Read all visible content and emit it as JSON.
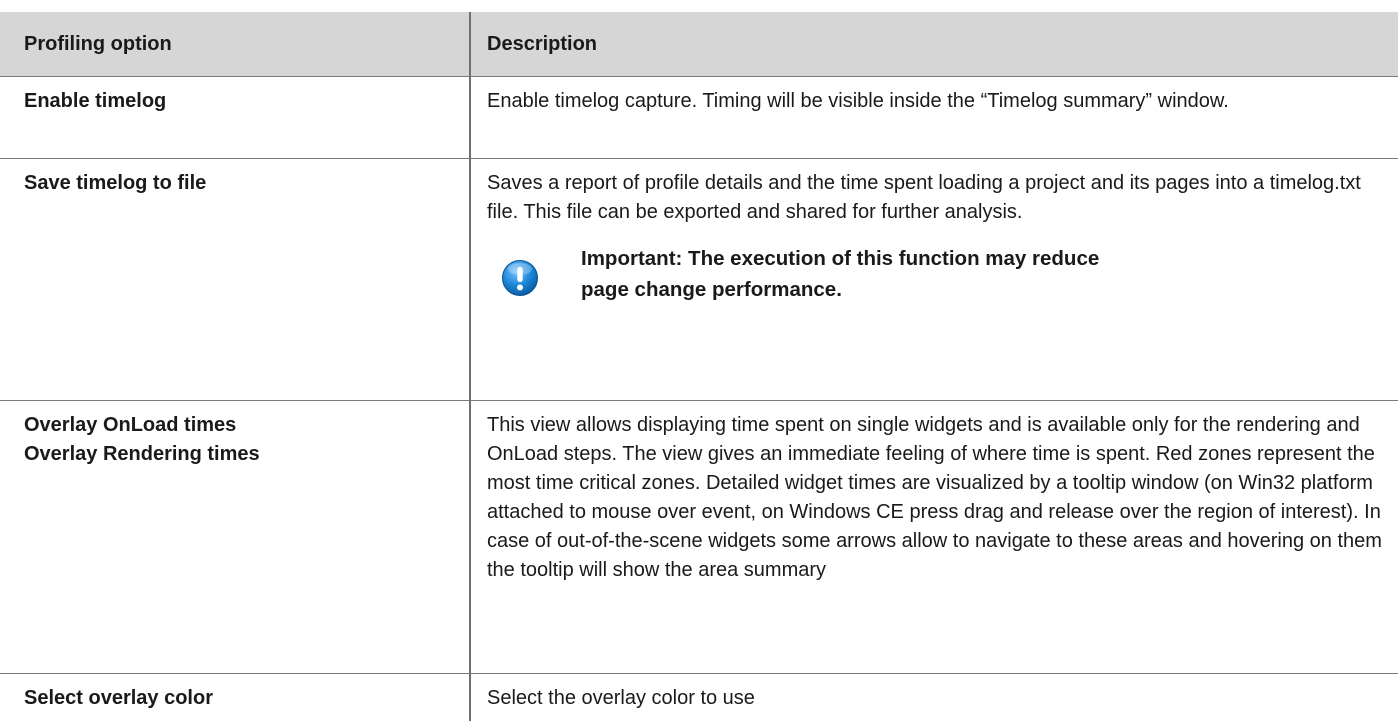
{
  "table": {
    "headers": {
      "option": "Profiling option",
      "description": "Description"
    },
    "rows": [
      {
        "option_lines": [
          "Enable timelog"
        ],
        "description": "Enable timelog capture. Timing will be visible inside the “Timelog summary” window."
      },
      {
        "option_lines": [
          "Save timelog to file"
        ],
        "description": "Saves a report of profile details and the time spent loading a project and its pages into a timelog.txt file. This file can be exported and shared for further analysis.",
        "note": {
          "icon": "exclamation-info-icon",
          "text": "Important: The execution of this function may reduce page change performance."
        }
      },
      {
        "option_lines": [
          "Overlay OnLoad times",
          "Overlay Rendering times"
        ],
        "description": "This view allows displaying time spent on single widgets and is available only for the rendering and OnLoad steps. The view gives an immediate feeling of where time is spent. Red zones represent the most time critical zones. Detailed widget times are visualized by a tooltip window (on Win32 platform attached to mouse over event, on Windows CE press drag and release over the region of interest). In case of out-of-the-scene widgets some arrows allow to navigate to these areas and hovering on them the tooltip will show the area summary"
      },
      {
        "option_lines": [
          "Select overlay color"
        ],
        "description": "Select the overlay color to use"
      }
    ]
  },
  "colors": {
    "header_bg": "#d6d6d6",
    "divider": "#7a7a7a",
    "icon_blue": "#1b86d6"
  }
}
